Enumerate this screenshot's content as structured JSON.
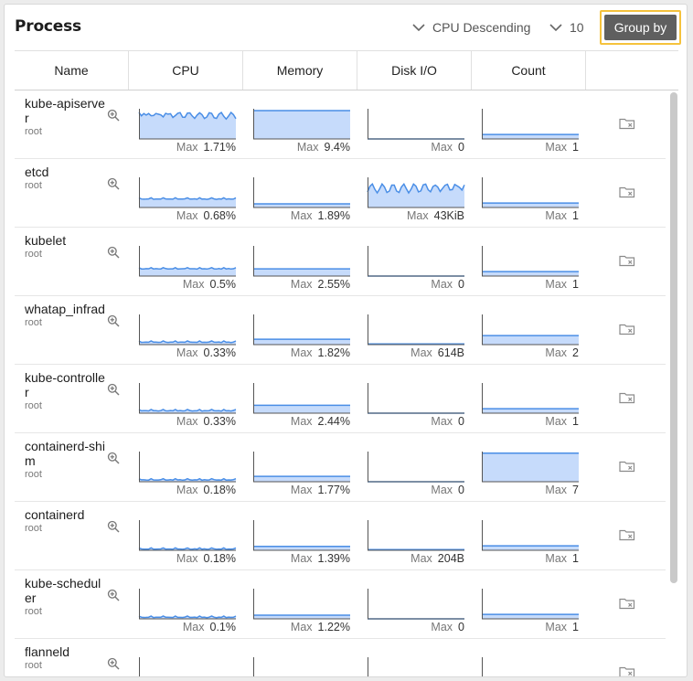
{
  "panel": {
    "title": "Process"
  },
  "controls": {
    "sort_label": "CPU Descending",
    "limit_label": "10",
    "group_by_label": "Group by"
  },
  "columns": [
    "Name",
    "CPU",
    "Memory",
    "Disk I/O",
    "Count"
  ],
  "max_label": "Max",
  "rows": [
    {
      "name": "kube-apiserver",
      "user": "root",
      "cpu_max": "1.71%",
      "mem_max": "9.4%",
      "disk_max": "0",
      "count_max": "1"
    },
    {
      "name": "etcd",
      "user": "root",
      "cpu_max": "0.68%",
      "mem_max": "1.89%",
      "disk_max": "43KiB",
      "count_max": "1"
    },
    {
      "name": "kubelet",
      "user": "root",
      "cpu_max": "0.5%",
      "mem_max": "2.55%",
      "disk_max": "0",
      "count_max": "1"
    },
    {
      "name": "whatap_infrad",
      "user": "root",
      "cpu_max": "0.33%",
      "mem_max": "1.82%",
      "disk_max": "614B",
      "count_max": "2"
    },
    {
      "name": "kube-controller",
      "user": "root",
      "cpu_max": "0.33%",
      "mem_max": "2.44%",
      "disk_max": "0",
      "count_max": "1"
    },
    {
      "name": "containerd-shim",
      "user": "root",
      "cpu_max": "0.18%",
      "mem_max": "1.77%",
      "disk_max": "0",
      "count_max": "7"
    },
    {
      "name": "containerd",
      "user": "root",
      "cpu_max": "0.18%",
      "mem_max": "1.39%",
      "disk_max": "204B",
      "count_max": "1"
    },
    {
      "name": "kube-scheduler",
      "user": "root",
      "cpu_max": "0.1%",
      "mem_max": "1.22%",
      "disk_max": "0",
      "count_max": "1"
    },
    {
      "name": "flanneld",
      "user": "root",
      "cpu_max": "",
      "mem_max": "",
      "disk_max": "",
      "count_max": ""
    }
  ],
  "icons": {
    "sort": "chevron-down-icon",
    "limit": "chevron-down-icon",
    "zoom": "zoom-in-icon",
    "folder": "folder-remove-icon"
  },
  "colors": {
    "accent": "#4a8ee6",
    "fill": "#c6dbfb",
    "highlight": "#f5c23c",
    "button": "#5f5f5f"
  }
}
